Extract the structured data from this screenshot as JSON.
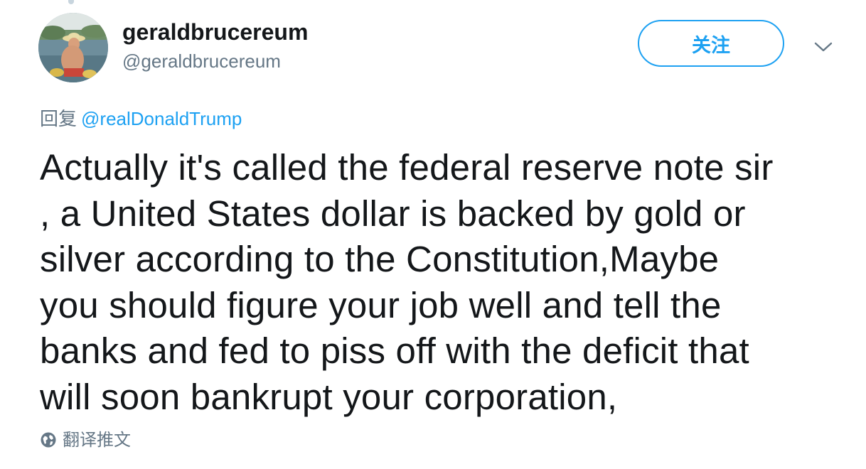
{
  "user": {
    "display_name": "geraldbrucereum",
    "handle": "@geraldbrucereum",
    "avatar_icon": "profile-photo"
  },
  "follow_button": {
    "label": "关注"
  },
  "menu": {
    "icon": "chevron-down-icon"
  },
  "reply": {
    "prefix": "回复",
    "mention": "@realDonaldTrump"
  },
  "tweet": {
    "lines": [
      "Actually it's called the federal reserve note sir",
      ", a United States dollar is backed by gold or",
      "silver according to the Constitution,Maybe",
      "you should figure your job well and tell the",
      "banks and fed to piss off with the deficit that",
      "will soon bankrupt your corporation,"
    ]
  },
  "translate": {
    "label": "翻译推文",
    "icon": "globe-icon"
  },
  "colors": {
    "accent": "#1da1f2",
    "text_primary": "#14171a",
    "text_secondary": "#657786"
  }
}
